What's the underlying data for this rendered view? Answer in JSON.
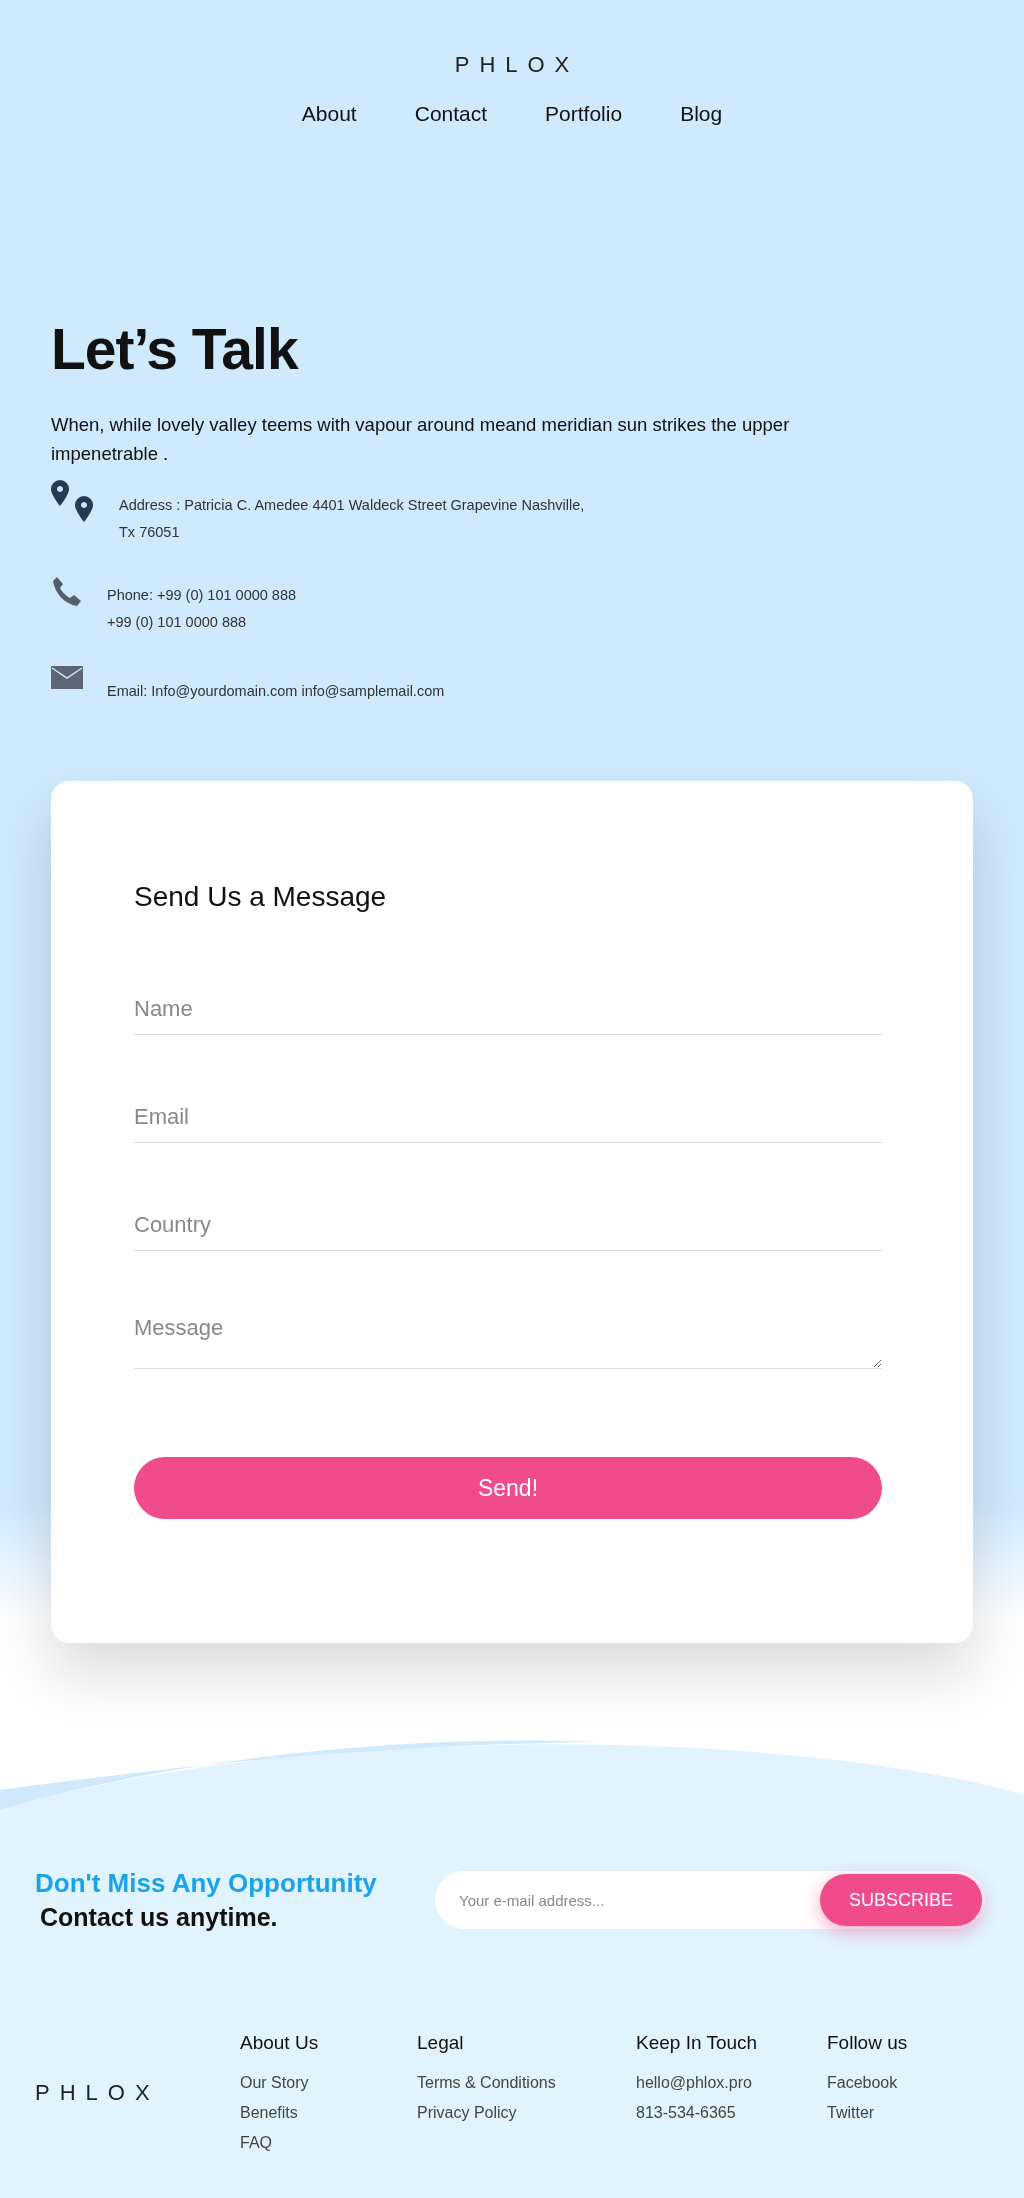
{
  "header": {
    "logo": "PHLOX",
    "nav": [
      {
        "label": "About"
      },
      {
        "label": "Contact"
      },
      {
        "label": "Portfolio"
      },
      {
        "label": "Blog"
      }
    ]
  },
  "hero": {
    "title": "Let’s Talk",
    "intro": "When, while lovely valley teems with vapour around meand meridian sun strikes the upper impenetrable .",
    "contacts": [
      {
        "kind": "address",
        "lines": [
          "Address : Patricia C. Amedee 4401 Waldeck Street Grapevine Nashville, Tx 76051"
        ]
      },
      {
        "kind": "phone",
        "lines": [
          "Phone: +99 (0) 101 0000 888",
          "+99 (0) 101 0000 888"
        ]
      },
      {
        "kind": "email",
        "lines": [
          "Email: Info@yourdomain.com info@samplemail.com"
        ]
      }
    ]
  },
  "form": {
    "title": "Send Us a Message",
    "fields": [
      {
        "kind": "input",
        "placeholder": "Name"
      },
      {
        "kind": "input",
        "placeholder": "Email"
      },
      {
        "kind": "input",
        "placeholder": "Country"
      },
      {
        "kind": "textarea",
        "placeholder": "Message"
      }
    ],
    "submit": "Send!"
  },
  "newsletter": {
    "headline": "Don't Miss Any Opportunity",
    "subline": "Contact us anytime.",
    "placeholder": "Your e-mail address...",
    "button": "SUBSCRIBE"
  },
  "footer": {
    "logo": "PHLOX",
    "columns": [
      {
        "title": "About Us",
        "links": [
          "Our Story",
          "Benefits",
          "FAQ"
        ]
      },
      {
        "title": "Legal",
        "links": [
          "Terms & Conditions",
          "Privacy Policy"
        ]
      },
      {
        "title": "Keep In Touch",
        "links": [
          "hello@phlox.pro",
          "813-534-6365"
        ]
      },
      {
        "title": "Follow us",
        "links": [
          "Facebook",
          "Twitter"
        ]
      }
    ]
  }
}
